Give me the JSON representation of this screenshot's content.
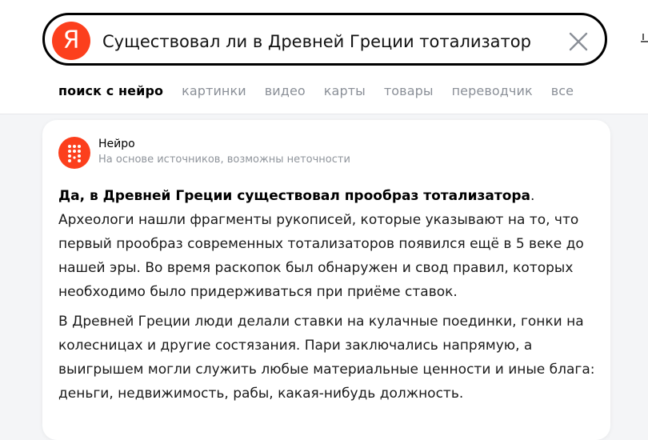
{
  "search": {
    "logo_letter": "Я",
    "query": "Существовал ли в Древней Греции тотализатор"
  },
  "tabs": [
    {
      "label": "поиск с нейро",
      "active": true
    },
    {
      "label": "картинки",
      "active": false
    },
    {
      "label": "видео",
      "active": false
    },
    {
      "label": "карты",
      "active": false
    },
    {
      "label": "товары",
      "active": false
    },
    {
      "label": "переводчик",
      "active": false
    },
    {
      "label": "все",
      "active": false
    }
  ],
  "neuro": {
    "name": "Нейро",
    "subtitle": "На основе источников, возможны неточности",
    "headline": "Да, в Древней Греции существовал прообраз тотализатора",
    "headline_end": ".",
    "paragraphs": [
      "Археологи нашли фрагменты рукописей, которые указывают на то, что первый прообраз современных тотализаторов появился ещё в 5 веке до нашей эры. Во время раскопок был обнаружен и свод правил, которых необходимо было придерживаться при приёме ставок.",
      "В Древней Греции люди делали ставки на кулачные поединки, гонки на колесницах и другие состязания. Пари заключались напрямую, а выигрышем могли служить любые материальные ценности и иные блага: деньги, недвижимость, рабы, какая-нибудь должность."
    ]
  },
  "colors": {
    "brand_red": "#fc3f1d",
    "muted_text": "#8a8f97",
    "page_bg": "#f4f5f7"
  },
  "icons": {
    "logo": "yandex-logo-icon",
    "clear": "close-icon",
    "neuro": "neuro-logo-icon"
  }
}
